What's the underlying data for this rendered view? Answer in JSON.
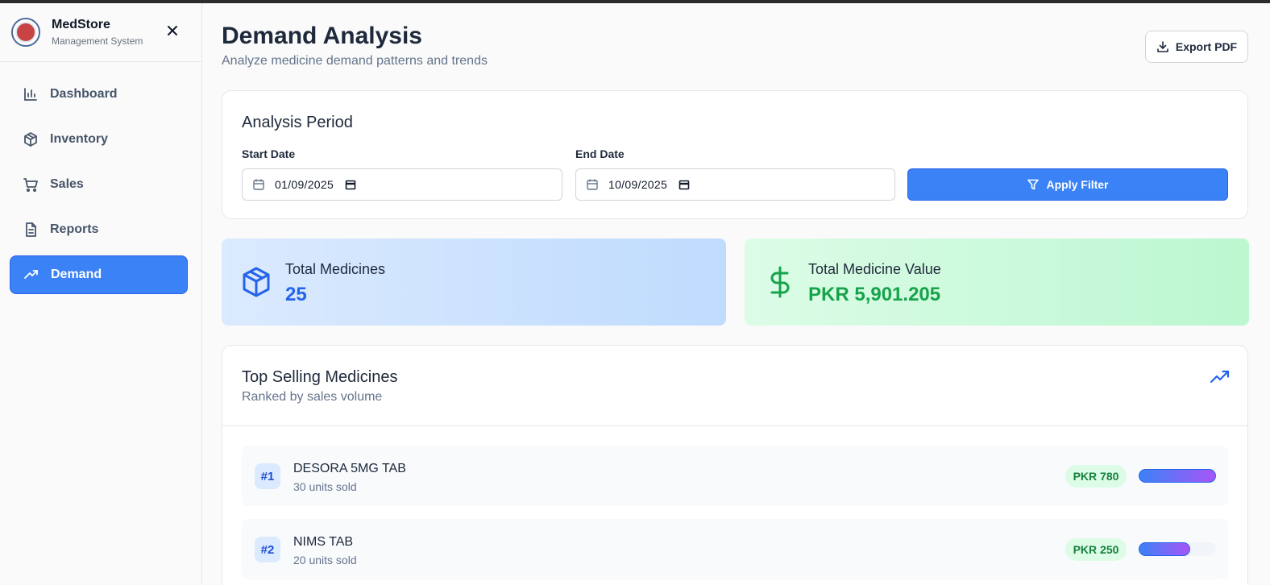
{
  "app": {
    "name": "MedStore",
    "subtitle": "Management System"
  },
  "sidebar": {
    "items": [
      {
        "label": "Dashboard",
        "icon": "bar-chart-icon"
      },
      {
        "label": "Inventory",
        "icon": "package-icon"
      },
      {
        "label": "Sales",
        "icon": "cart-icon"
      },
      {
        "label": "Reports",
        "icon": "document-icon"
      },
      {
        "label": "Demand",
        "icon": "trending-up-icon",
        "active": true
      }
    ]
  },
  "header": {
    "title": "Demand Analysis",
    "subtitle": "Analyze medicine demand patterns and trends",
    "export_label": "Export PDF"
  },
  "period": {
    "title": "Analysis Period",
    "start_label": "Start Date",
    "start_value": "01/09/2025",
    "end_label": "End Date",
    "end_value": "10/09/2025",
    "apply_label": "Apply Filter"
  },
  "stats": {
    "total_medicines_label": "Total Medicines",
    "total_medicines_value": "25",
    "total_value_label": "Total Medicine Value",
    "total_value_value": "PKR 5,901.205"
  },
  "top_selling": {
    "title": "Top Selling Medicines",
    "subtitle": "Ranked by sales volume",
    "items": [
      {
        "rank": "#1",
        "name": "DESORA 5MG TAB",
        "units": "30 units sold",
        "price": "PKR 780",
        "share": 1.0
      },
      {
        "rank": "#2",
        "name": "NIMS TAB",
        "units": "20 units sold",
        "price": "PKR 250",
        "share": 0.667
      }
    ]
  },
  "colors": {
    "accent": "#3b82f6",
    "stat_blue_text": "#2563eb",
    "stat_green_text": "#16a34a"
  }
}
